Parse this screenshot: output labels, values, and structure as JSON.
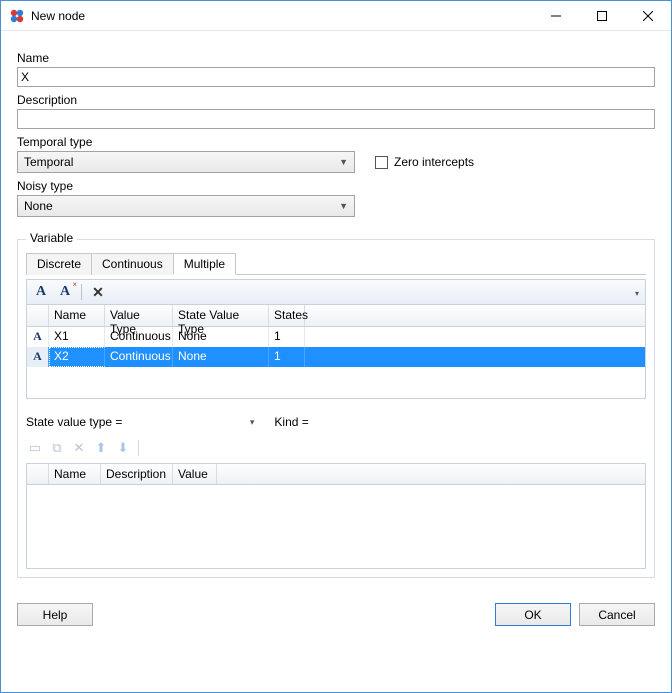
{
  "window": {
    "title": "New node"
  },
  "form": {
    "name_label": "Name",
    "name_value": "X",
    "desc_label": "Description",
    "desc_value": "",
    "temporal_label": "Temporal type",
    "temporal_value": "Temporal",
    "zero_label": "Zero intercepts",
    "zero_checked": false,
    "noisy_label": "Noisy type",
    "noisy_value": "None"
  },
  "variable": {
    "legend": "Variable",
    "tabs": [
      "Discrete",
      "Continuous",
      "Multiple"
    ],
    "active_tab": 2,
    "columns": [
      "Name",
      "Value Type",
      "State Value Type",
      "States"
    ],
    "rows": [
      {
        "icon": "A",
        "name": "X1",
        "value_type": "Continuous",
        "state_value_type": "None",
        "states": "1",
        "selected": false
      },
      {
        "icon": "A",
        "name": "X2",
        "value_type": "Continuous",
        "state_value_type": "None",
        "states": "1",
        "selected": true
      }
    ],
    "state_value_label": "State value type =",
    "state_value_value": "",
    "kind_label": "Kind =",
    "kind_value": "",
    "columns2": [
      "Name",
      "Description",
      "Value"
    ]
  },
  "buttons": {
    "help": "Help",
    "ok": "OK",
    "cancel": "Cancel"
  }
}
